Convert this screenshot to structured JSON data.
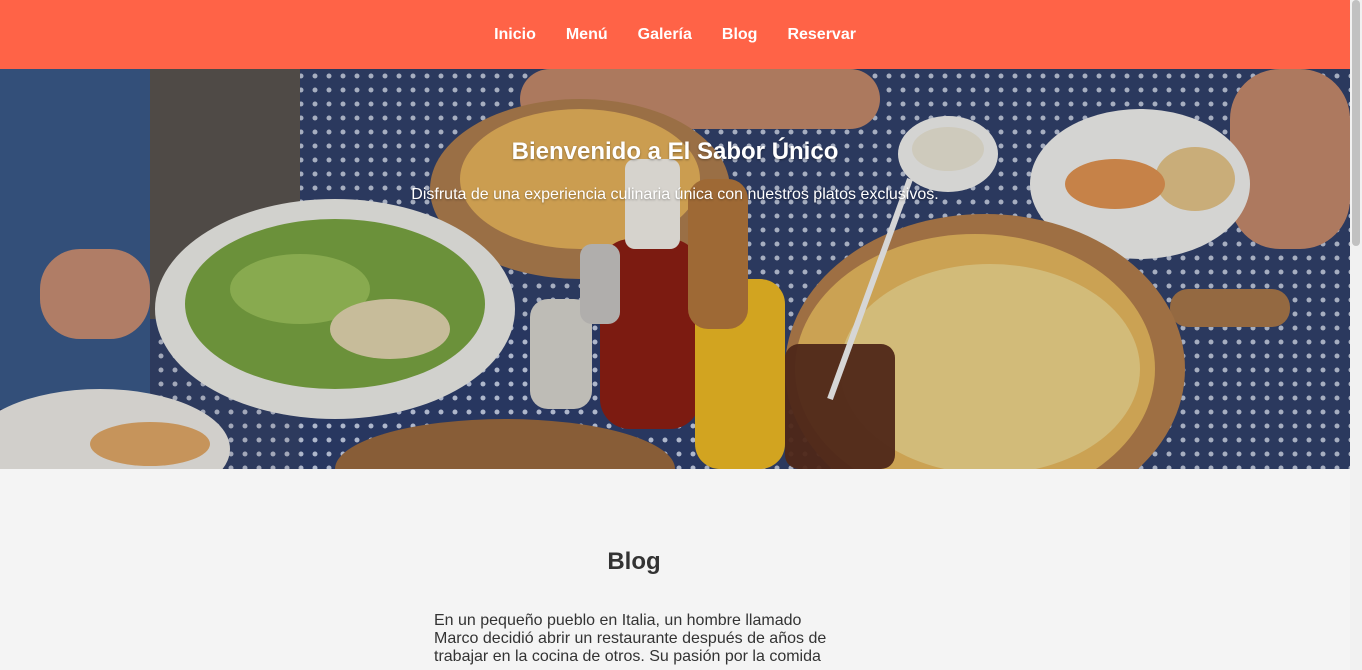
{
  "nav": {
    "items": [
      "Inicio",
      "Menú",
      "Galería",
      "Blog",
      "Reservar"
    ]
  },
  "hero": {
    "title": "Bienvenido a El Sabor Único",
    "subtitle": "Disfruta de una experiencia culinaria única con nuestros platos exclusivos."
  },
  "blog": {
    "title": "Blog",
    "text": "En un pequeño pueblo en Italia, un hombre llamado Marco decidió abrir un restaurante después de años de trabajar en la cocina de otros. Su pasión por la comida"
  },
  "colors": {
    "nav_background": "#ff6347",
    "page_background": "#f4f4f4",
    "text": "#333333"
  }
}
